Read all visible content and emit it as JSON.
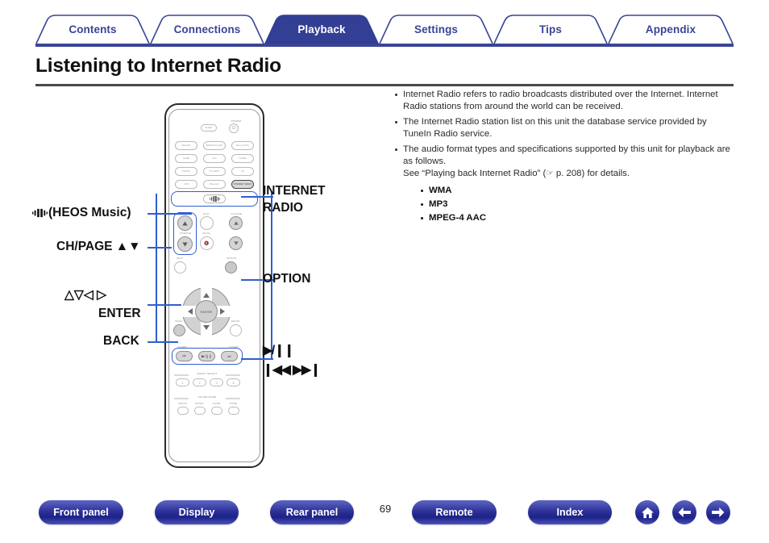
{
  "tabs": [
    {
      "label": "Contents",
      "active": false,
      "name": "tab-contents"
    },
    {
      "label": "Connections",
      "active": false,
      "name": "tab-connections"
    },
    {
      "label": "Playback",
      "active": true,
      "name": "tab-playback"
    },
    {
      "label": "Settings",
      "active": false,
      "name": "tab-settings"
    },
    {
      "label": "Tips",
      "active": false,
      "name": "tab-tips"
    },
    {
      "label": "Appendix",
      "active": false,
      "name": "tab-appendix"
    }
  ],
  "page": {
    "title": "Listening to Internet Radio",
    "number": "69"
  },
  "notes": [
    "Internet Radio refers to radio broadcasts distributed over the Internet. Internet Radio stations from around the world can be received.",
    "The Internet Radio station list on this unit the database service provided by TuneIn Radio service.",
    "The audio format types and specifications supported by this unit for playback are as follows."
  ],
  "see_also": {
    "prefix": "See “Playing back Internet Radio” (",
    "hand_icon": "☞",
    "page_ref": " p. 208",
    "suffix": ") for details."
  },
  "formats": [
    "WMA",
    "MP3",
    "MPEG-4 AAC"
  ],
  "callouts": {
    "heos": "(HEOS Music)",
    "heos_icon": "heos-speaker-icon",
    "chpage": "CH/PAGE ▲▼",
    "cursor": "△▽◁ ▷",
    "enter": "ENTER",
    "back": "BACK",
    "internet_radio_line1": "INTERNET",
    "internet_radio_line2": "RADIO",
    "option": "OPTION",
    "playpause": "▶/❙❙",
    "skip": "❙◀◀ ▶▶❙"
  },
  "remote": {
    "power_cap": "POWER",
    "sleep": "SLEEP",
    "power": "⏻",
    "sources": [
      [
        "CBL/SAT",
        "MEDIA PLAYER",
        "Blu-ray DVD"
      ],
      [
        "GAME",
        "AUX",
        "TUNER"
      ],
      [
        "PHONO",
        "TV AUDIO",
        "CD"
      ],
      [
        "USB",
        "Bluetooth",
        "INTERNET RADIO"
      ]
    ],
    "heos_button": "heos-music-button",
    "eco_cap": "ECO",
    "volume_cap": "VOLUME",
    "mute_cap": "MUTE",
    "chpage_cap": "CH/PAGE",
    "info_cap": "INFO",
    "option_cap": "OPTION",
    "back_cap": "BACK",
    "setup_cap": "SETUP",
    "enter_cap": "ENTER",
    "tuner_minus": "TUNER -",
    "tuner_plus": "TUNER +",
    "transport": [
      "⏮",
      "▶/❙❙",
      "⏭"
    ],
    "smart_select_cap": "SMART SELECT",
    "smart_select": [
      "1",
      "2",
      "3",
      "4"
    ],
    "sound_mode_cap": "SOUND MODE",
    "sound_modes": [
      "MOVIE",
      "MUSIC",
      "GAME",
      "PURE"
    ]
  },
  "footer": {
    "buttons": [
      {
        "label": "Front panel",
        "name": "front-panel-button"
      },
      {
        "label": "Display",
        "name": "display-button"
      },
      {
        "label": "Rear panel",
        "name": "rear-panel-button"
      },
      {
        "label": "Remote",
        "name": "remote-button"
      },
      {
        "label": "Index",
        "name": "index-button"
      }
    ],
    "icons": [
      {
        "name": "home-icon",
        "glyph": "⌂"
      },
      {
        "name": "back-arrow-icon",
        "glyph": "←"
      },
      {
        "name": "forward-arrow-icon",
        "glyph": "→"
      }
    ]
  },
  "colors": {
    "accent": "#3a4596",
    "active_tab": "#333f94",
    "leader": "#2f5fd0",
    "text": "#1a1a1a"
  }
}
